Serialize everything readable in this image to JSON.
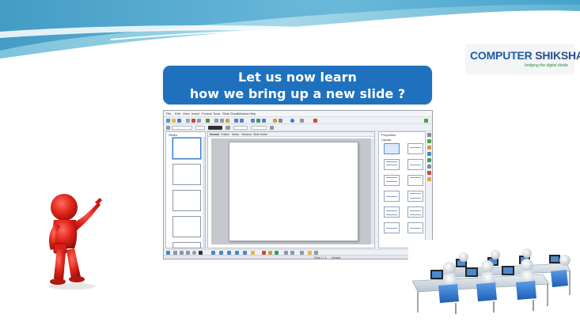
{
  "brand": {
    "logo_part1": "COMPUTER",
    "logo_part2": " SHIKSHA",
    "tagline": "bridging the digital divide",
    "primary_color": "#1d5aa6",
    "accent_color": "#2b8d3c"
  },
  "heading": {
    "line1": "Let us now learn",
    "line2": "how we bring up a new slide ?",
    "background_color": "#1f71bd"
  },
  "app": {
    "menu": [
      "File",
      "Edit",
      "View",
      "Insert",
      "Format",
      "Tools",
      "Slide Show",
      "Window",
      "Help"
    ],
    "slides_pane_title": "Slides",
    "view_tabs": [
      "Normal",
      "Outline",
      "Notes",
      "Handout",
      "Slide Sorter"
    ],
    "properties_title": "Properties",
    "layouts_label": "Layouts",
    "status": [
      "Slide 1 / 1",
      "Default"
    ]
  },
  "illustrations": {
    "presenter": "red-presenter-figure",
    "classroom": "computer-lab-figures"
  }
}
